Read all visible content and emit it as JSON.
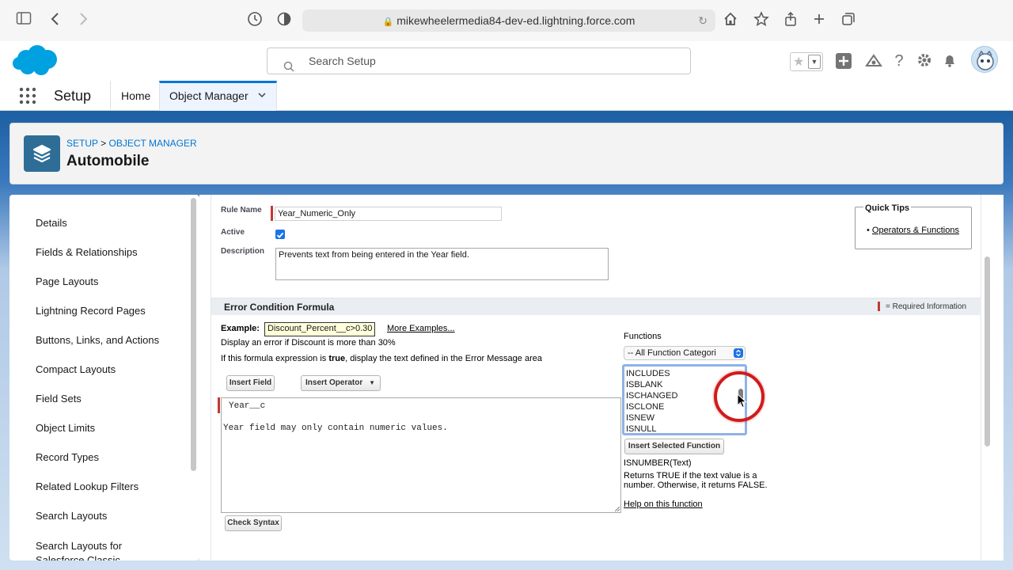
{
  "browser": {
    "url": "mikewheelermedia84-dev-ed.lightning.force.com"
  },
  "header": {
    "search_placeholder": "Search Setup",
    "help": "?"
  },
  "nav": {
    "app_name": "Setup",
    "tabs": [
      {
        "label": "Home"
      },
      {
        "label": "Object Manager"
      }
    ]
  },
  "page": {
    "breadcrumb_setup": "SETUP",
    "breadcrumb_sep": ">",
    "breadcrumb_om": "OBJECT MANAGER",
    "title": "Automobile"
  },
  "sidebar": {
    "items": [
      {
        "label": "Details"
      },
      {
        "label": "Fields & Relationships"
      },
      {
        "label": "Page Layouts"
      },
      {
        "label": "Lightning Record Pages"
      },
      {
        "label": "Buttons, Links, and Actions"
      },
      {
        "label": "Compact Layouts"
      },
      {
        "label": "Field Sets"
      },
      {
        "label": "Object Limits"
      },
      {
        "label": "Record Types"
      },
      {
        "label": "Related Lookup Filters"
      },
      {
        "label": "Search Layouts"
      },
      {
        "label": "Search Layouts for Salesforce Classic"
      }
    ]
  },
  "form": {
    "rule_name_label": "Rule Name",
    "rule_name_value": "Year_Numeric_Only",
    "active_label": "Active",
    "active_checked": true,
    "description_label": "Description",
    "description_value": "Prevents text from being entered in the Year field.",
    "section_title": "Error Condition Formula",
    "required_info": "= Required Information",
    "example_label": "Example:",
    "example_value": "Discount_Percent__c>0.30",
    "more_examples": "More Examples...",
    "example_desc": "Display an error if Discount is more than 30%",
    "expression_prefix": "If this formula expression is ",
    "expression_bold": "true",
    "expression_suffix": ", display the text defined in the Error Message area",
    "insert_field": "Insert Field",
    "insert_operator": "Insert Operator",
    "formula_line1": "Year__c",
    "formula_line2": "Year field may only contain numeric values.",
    "check_syntax": "Check Syntax"
  },
  "functions": {
    "label": "Functions",
    "category_selected": "-- All Function Categori",
    "list": [
      "INCLUDES",
      "ISBLANK",
      "ISCHANGED",
      "ISCLONE",
      "ISNEW",
      "ISNULL"
    ],
    "insert_selected": "Insert Selected Function",
    "signature": "ISNUMBER(Text)",
    "desc_line1": "Returns TRUE if the text value is a",
    "desc_line2": "number. Otherwise, it returns FALSE.",
    "help_link": "Help on this function"
  },
  "quick_tips": {
    "title": "Quick Tips",
    "link": "Operators & Functions"
  },
  "colors": {
    "sf_blue": "#00a1e0",
    "link_blue": "#0176d3",
    "required_red": "#c23934",
    "highlight_circle": "#d11b1b"
  }
}
